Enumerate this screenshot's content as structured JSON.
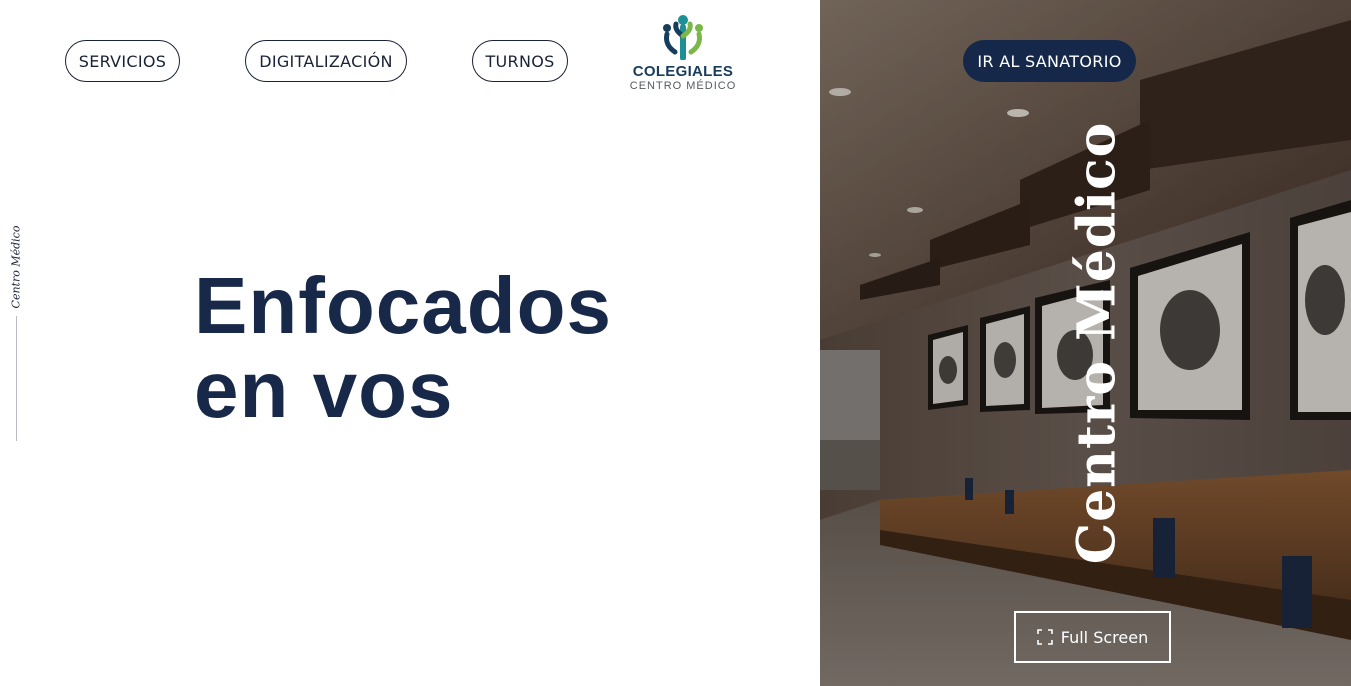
{
  "nav": {
    "items": [
      {
        "label": "SERVICIOS"
      },
      {
        "label": "DIGITALIZACIÓN"
      },
      {
        "label": "TURNOS"
      }
    ],
    "sanatorio_button": "IR AL SANATORIO"
  },
  "logo": {
    "name": "COLEGIALES",
    "subtitle": "CENTRO MÉDICO",
    "colors": {
      "teal": "#1e8f94",
      "blue": "#173c5c",
      "green": "#7ab648"
    }
  },
  "side_label": "Centro Médico",
  "hero": {
    "line1": "Enfocados",
    "line2": "en vos"
  },
  "photo_panel": {
    "title": "Centro Médico",
    "fullscreen_label": "Full Screen",
    "fullscreen_icon": "expand-icon"
  },
  "colors": {
    "primary": "#172848",
    "button_dark": "#16284a",
    "text_light": "#ffffff"
  }
}
